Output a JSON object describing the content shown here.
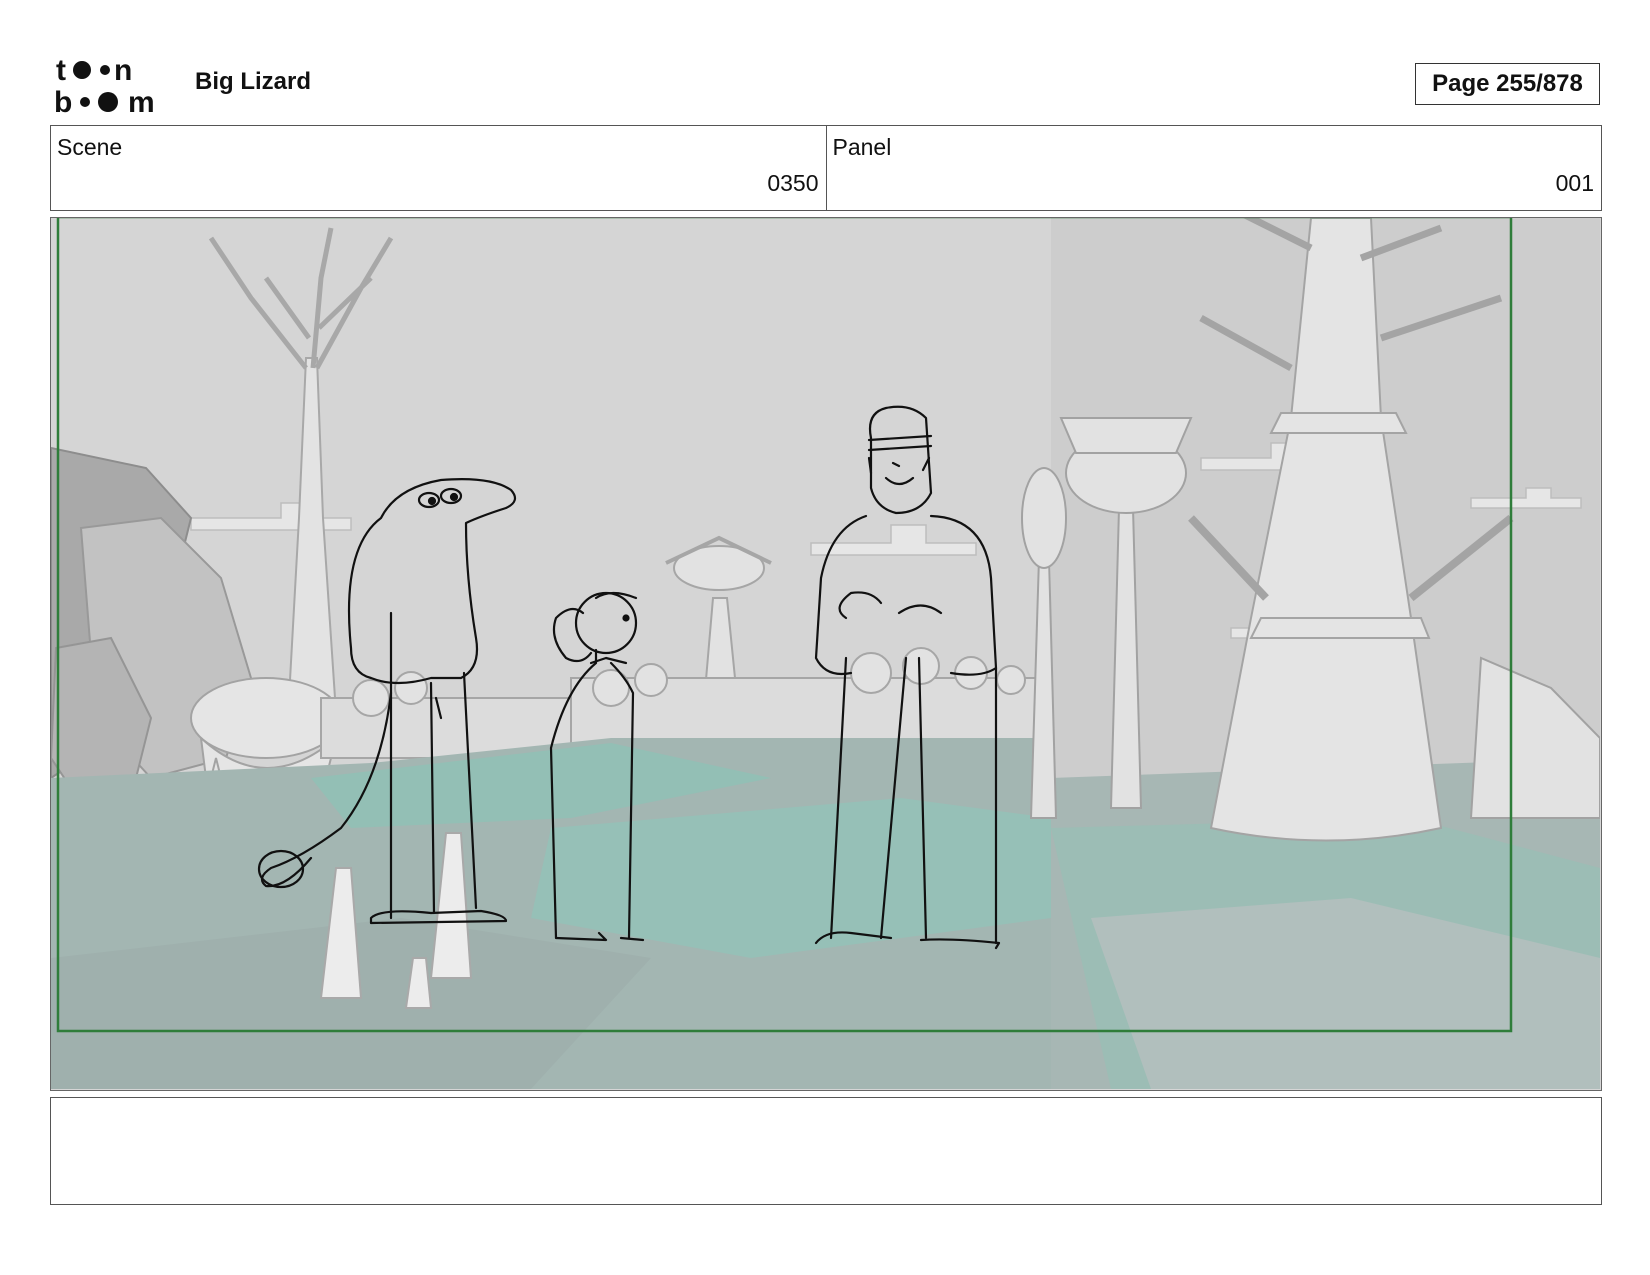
{
  "header": {
    "logo_line1": "toon",
    "logo_line2": "boom",
    "project_title": "Big Lizard",
    "page_indicator": "Page 255/878"
  },
  "info": {
    "scene_label": "Scene",
    "scene_value": "0350",
    "panel_label": "Panel",
    "panel_value": "001"
  },
  "notes": {
    "text": ""
  },
  "colors": {
    "frame_line": "#2f7d3a",
    "ground": "#a6b8b4",
    "ground_teal": "#8fbab2",
    "sky": "#d7d7d7",
    "scenery": "#ececec",
    "sketch_ink": "#111111"
  }
}
